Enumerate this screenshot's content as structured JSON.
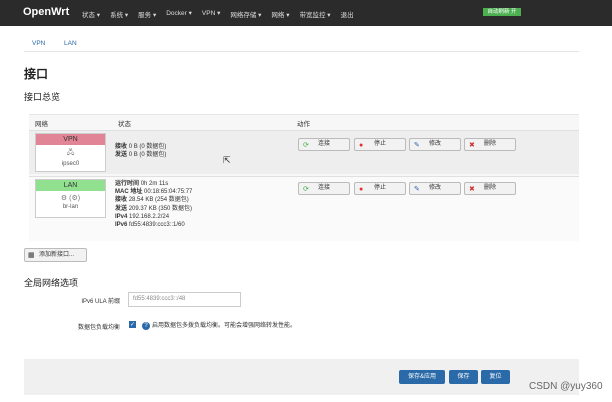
{
  "topbar": {
    "brand": "OpenWrt",
    "menu": [
      "状态 ▾",
      "系统 ▾",
      "服务 ▾",
      "Docker ▾",
      "VPN ▾",
      "网络存储 ▾",
      "网络 ▾",
      "带宽监控 ▾",
      "退出"
    ],
    "autorefresh": "自动刷新 开"
  },
  "tabs": [
    "VPN",
    "LAN"
  ],
  "page_title": "接口",
  "section_title": "接口总览",
  "table": {
    "headers": {
      "network": "网络",
      "status": "状态",
      "actions": "动作"
    },
    "rows": [
      {
        "name": "VPN",
        "color": "#e08496",
        "icon": "🖧",
        "device": "ipsec0",
        "status": [
          {
            "k": "接收",
            "v": "0 B (0 数据包)"
          },
          {
            "k": "发送",
            "v": "0 B (0 数据包)"
          }
        ]
      },
      {
        "name": "LAN",
        "color": "#90e090",
        "icon": "⚙ (⚙)",
        "device": "br-lan",
        "status": [
          {
            "k": "运行时间",
            "v": "0h 2m 11s"
          },
          {
            "k": "MAC 地址",
            "v": "00:18:65:04:75:77"
          },
          {
            "k": "接收",
            "v": "28.54 KB (254 数据包)"
          },
          {
            "k": "发送",
            "v": "209.37 KB (350 数据包)"
          },
          {
            "k": "IPv4",
            "v": "192.168.2.2/24"
          },
          {
            "k": "IPv6",
            "v": "fd55:4839:ccc3::1/60"
          }
        ]
      }
    ],
    "actions": [
      "连接",
      "停止",
      "修改",
      "删除"
    ]
  },
  "add_button": "添加新接口...",
  "global_title": "全局网络选项",
  "ula_label": "IPv6 ULA 前缀",
  "ula_value": "fd55:4839:ccc3::/48",
  "lb_label": "数据包负载均衡",
  "lb_help": "启用数据包多拨负载均衡。可能会增强网络转发性能。",
  "footer_buttons": [
    "保存&应用",
    "保存",
    "复位"
  ],
  "watermark": "CSDN @yuy360",
  "colors": {
    "accent": "#2a6aa8",
    "topbar": "#2b2b2b",
    "autorefresh": "#4caf50"
  }
}
